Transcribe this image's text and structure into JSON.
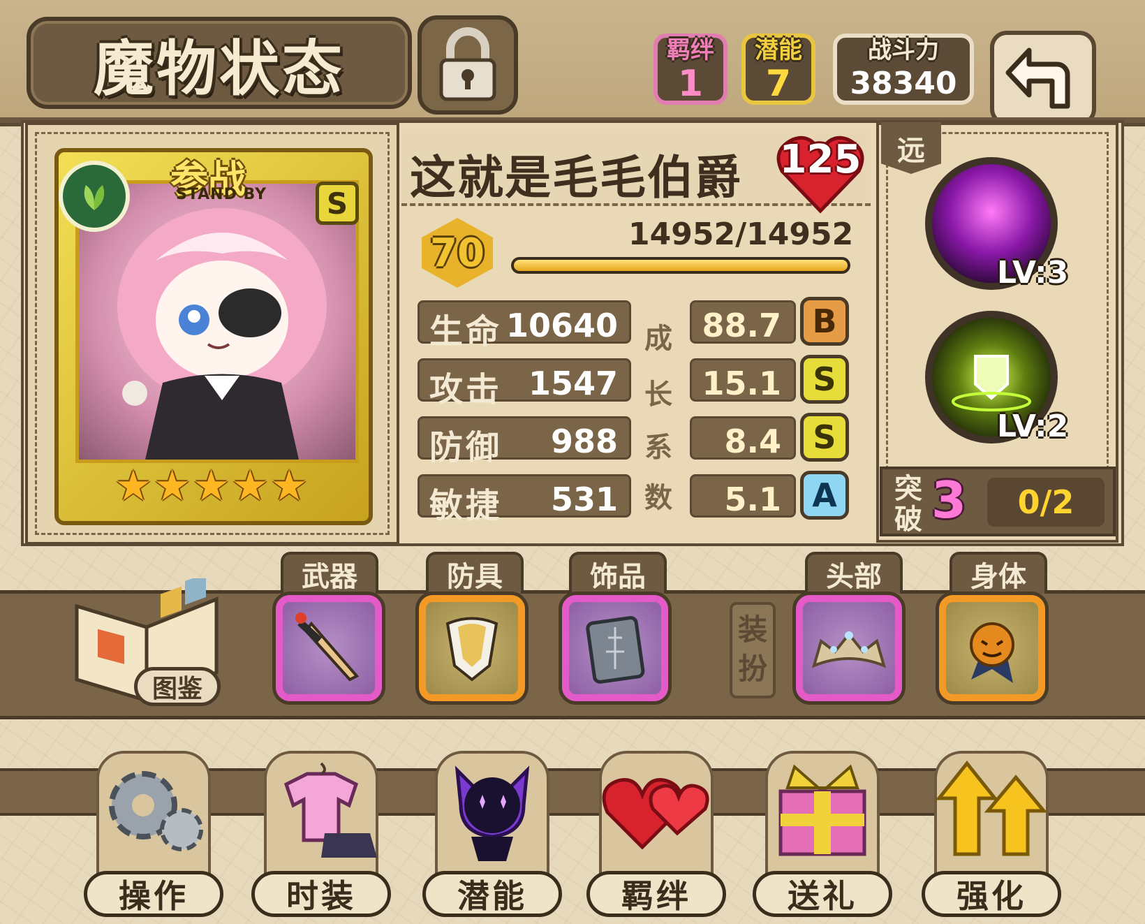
{
  "header": {
    "title": "魔物状态",
    "bond_label": "羁绊",
    "bond_value": "1",
    "potential_label": "潜能",
    "potential_value": "7",
    "power_label": "战斗力",
    "power_value": "38340"
  },
  "card": {
    "standby_label": "参战",
    "standby_sub": "STAND BY",
    "rank": "S",
    "stars": 5
  },
  "monster": {
    "name": "这就是毛毛伯爵",
    "affection": "125",
    "level": "70",
    "hp_text": "14952/14952",
    "hp_fraction": 1.0
  },
  "growth_label_chars": [
    "成",
    "长",
    "系",
    "数"
  ],
  "stats": [
    {
      "label": "生命",
      "value": "10640",
      "growth": "88.7",
      "grade": "B"
    },
    {
      "label": "攻击",
      "value": "1547",
      "growth": "15.1",
      "grade": "S"
    },
    {
      "label": "防御",
      "value": "988",
      "growth": "8.4",
      "grade": "S"
    },
    {
      "label": "敏捷",
      "value": "531",
      "growth": "5.1",
      "grade": "A"
    }
  ],
  "skills": {
    "range_label": "远",
    "items": [
      {
        "level": "LV:3",
        "icon": "purple-starfall-icon"
      },
      {
        "level": "LV:2",
        "icon": "green-shield-icon"
      }
    ],
    "break_label": "突破",
    "break_count": "3",
    "break_progress": "0/2"
  },
  "equipment": {
    "codex_label": "图鉴",
    "dressup_label": "装扮",
    "slots": [
      {
        "label": "武器",
        "icon": "sword-icon",
        "rarity": "purple"
      },
      {
        "label": "防具",
        "icon": "shield-armor-icon",
        "rarity": "orange"
      },
      {
        "label": "饰品",
        "icon": "stone-tablet-icon",
        "rarity": "purple"
      },
      {
        "label": "头部",
        "icon": "tiara-icon",
        "rarity": "purple"
      },
      {
        "label": "身体",
        "icon": "pumpkin-cape-icon",
        "rarity": "orange"
      }
    ]
  },
  "nav": [
    {
      "label": "操作",
      "icon": "gear-icon"
    },
    {
      "label": "时装",
      "icon": "outfit-icon"
    },
    {
      "label": "潜能",
      "icon": "shadow-demon-icon"
    },
    {
      "label": "羁绊",
      "icon": "hearts-icon"
    },
    {
      "label": "送礼",
      "icon": "gift-icon"
    },
    {
      "label": "强化",
      "icon": "upgrade-arrows-icon"
    }
  ],
  "colors": {
    "accent_pink": "#ff8cc6",
    "accent_yellow": "#ffd93d",
    "panel_brown": "#7a6548",
    "grade_B": "#e69b47",
    "grade_S": "#e6dc3a",
    "grade_A": "#8fd6f2"
  }
}
